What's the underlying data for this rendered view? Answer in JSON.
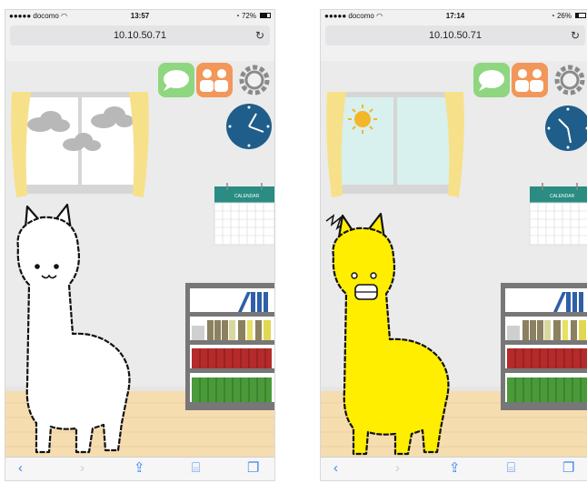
{
  "screens": [
    {
      "status": {
        "carrier": "docomo",
        "time": "13:57",
        "battery": "72%",
        "battery_level": 0.72
      },
      "url": "10.10.50.71",
      "weather": "cloudy",
      "calendar_label": "CALENDAR",
      "alpaca_color": "#ffffff",
      "alpaca_mood": "happy"
    },
    {
      "status": {
        "carrier": "docomo",
        "time": "17:14",
        "battery": "26%",
        "battery_level": 0.26
      },
      "url": "10.10.50.71",
      "weather": "sunny",
      "calendar_label": "CALENDAR",
      "alpaca_color": "#ffee00",
      "alpaca_mood": "angry"
    }
  ],
  "icons": {
    "chat": "chat-bubble-icon",
    "friends": "friends-icon",
    "settings": "gear-icon",
    "clock": "clock-icon",
    "reload": "reload-icon"
  },
  "toolbar": {
    "back": "‹",
    "forward": "›"
  },
  "colors": {
    "wall": "#ebebeb",
    "floor": "#f5ddb0",
    "curtain": "#f6e18a",
    "clock": "#1f5e8a",
    "chat_button": "#8fd680",
    "friends_button": "#f2975a",
    "calendar_header": "#2a8c82",
    "link_blue": "#3f86ea"
  }
}
